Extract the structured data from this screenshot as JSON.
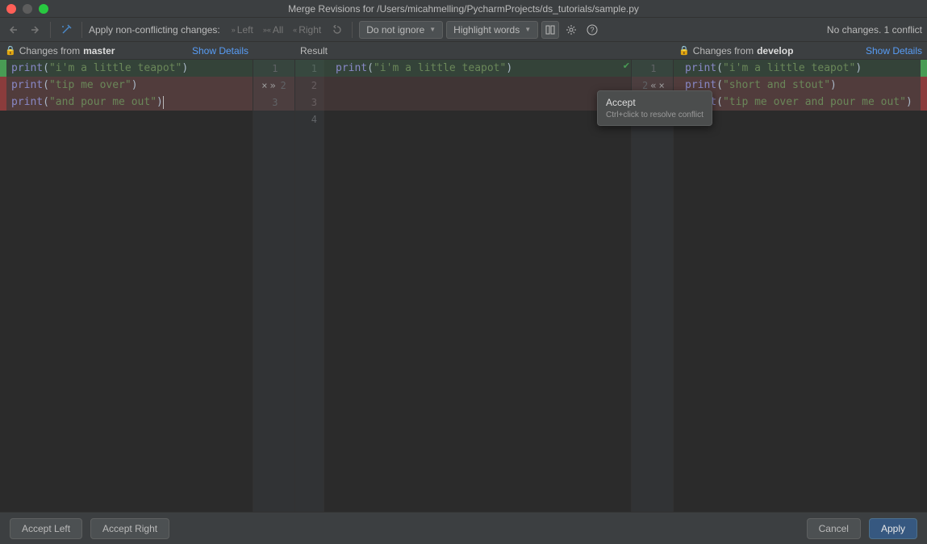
{
  "title": "Merge Revisions for /Users/micahmelling/PycharmProjects/ds_tutorials/sample.py",
  "toolbar": {
    "apply_label": "Apply non-conflicting changes:",
    "left": "Left",
    "all": "All",
    "right": "Right",
    "do_not_ignore": "Do not ignore",
    "highlight_words": "Highlight words",
    "status": "No changes. 1 conflict"
  },
  "headers": {
    "left_prefix": "Changes from ",
    "left_branch": "master",
    "result": "Result",
    "right_prefix": "Changes from ",
    "right_branch": "develop",
    "show_details": "Show Details"
  },
  "left_lines": [
    {
      "call": "print",
      "str": "\"i'm a little teapot\"",
      "kind": "accepted"
    },
    {
      "call": "print",
      "str": "\"tip me over\"",
      "kind": "conflict"
    },
    {
      "call": "print",
      "str": "\"and pour me out\"",
      "kind": "conflict",
      "cursor": true
    }
  ],
  "mid_lines": [
    {
      "n": "1",
      "call": "print",
      "str": "\"i'm a little teapot\""
    },
    {
      "n": "2"
    },
    {
      "n": "3"
    },
    {
      "n": "4"
    }
  ],
  "right_lines": [
    {
      "call": "print",
      "str": "\"i'm a little teapot\"",
      "kind": "accepted"
    },
    {
      "call": "print",
      "str": "\"short and stout\"",
      "kind": "conflict"
    },
    {
      "call": "print",
      "str": "\"tip me over and pour me out\"",
      "kind": "conflict"
    }
  ],
  "gutter_left": [
    {
      "num": "1"
    },
    {
      "btns": "× »",
      "num": "2"
    },
    {
      "num": "3"
    }
  ],
  "gutter_right": [
    {
      "num": "1"
    },
    {
      "num": "2",
      "btns": "« ×"
    }
  ],
  "tooltip": {
    "title": "Accept",
    "sub": "Ctrl+click to resolve conflict"
  },
  "footer": {
    "accept_left": "Accept Left",
    "accept_right": "Accept Right",
    "cancel": "Cancel",
    "apply": "Apply"
  }
}
